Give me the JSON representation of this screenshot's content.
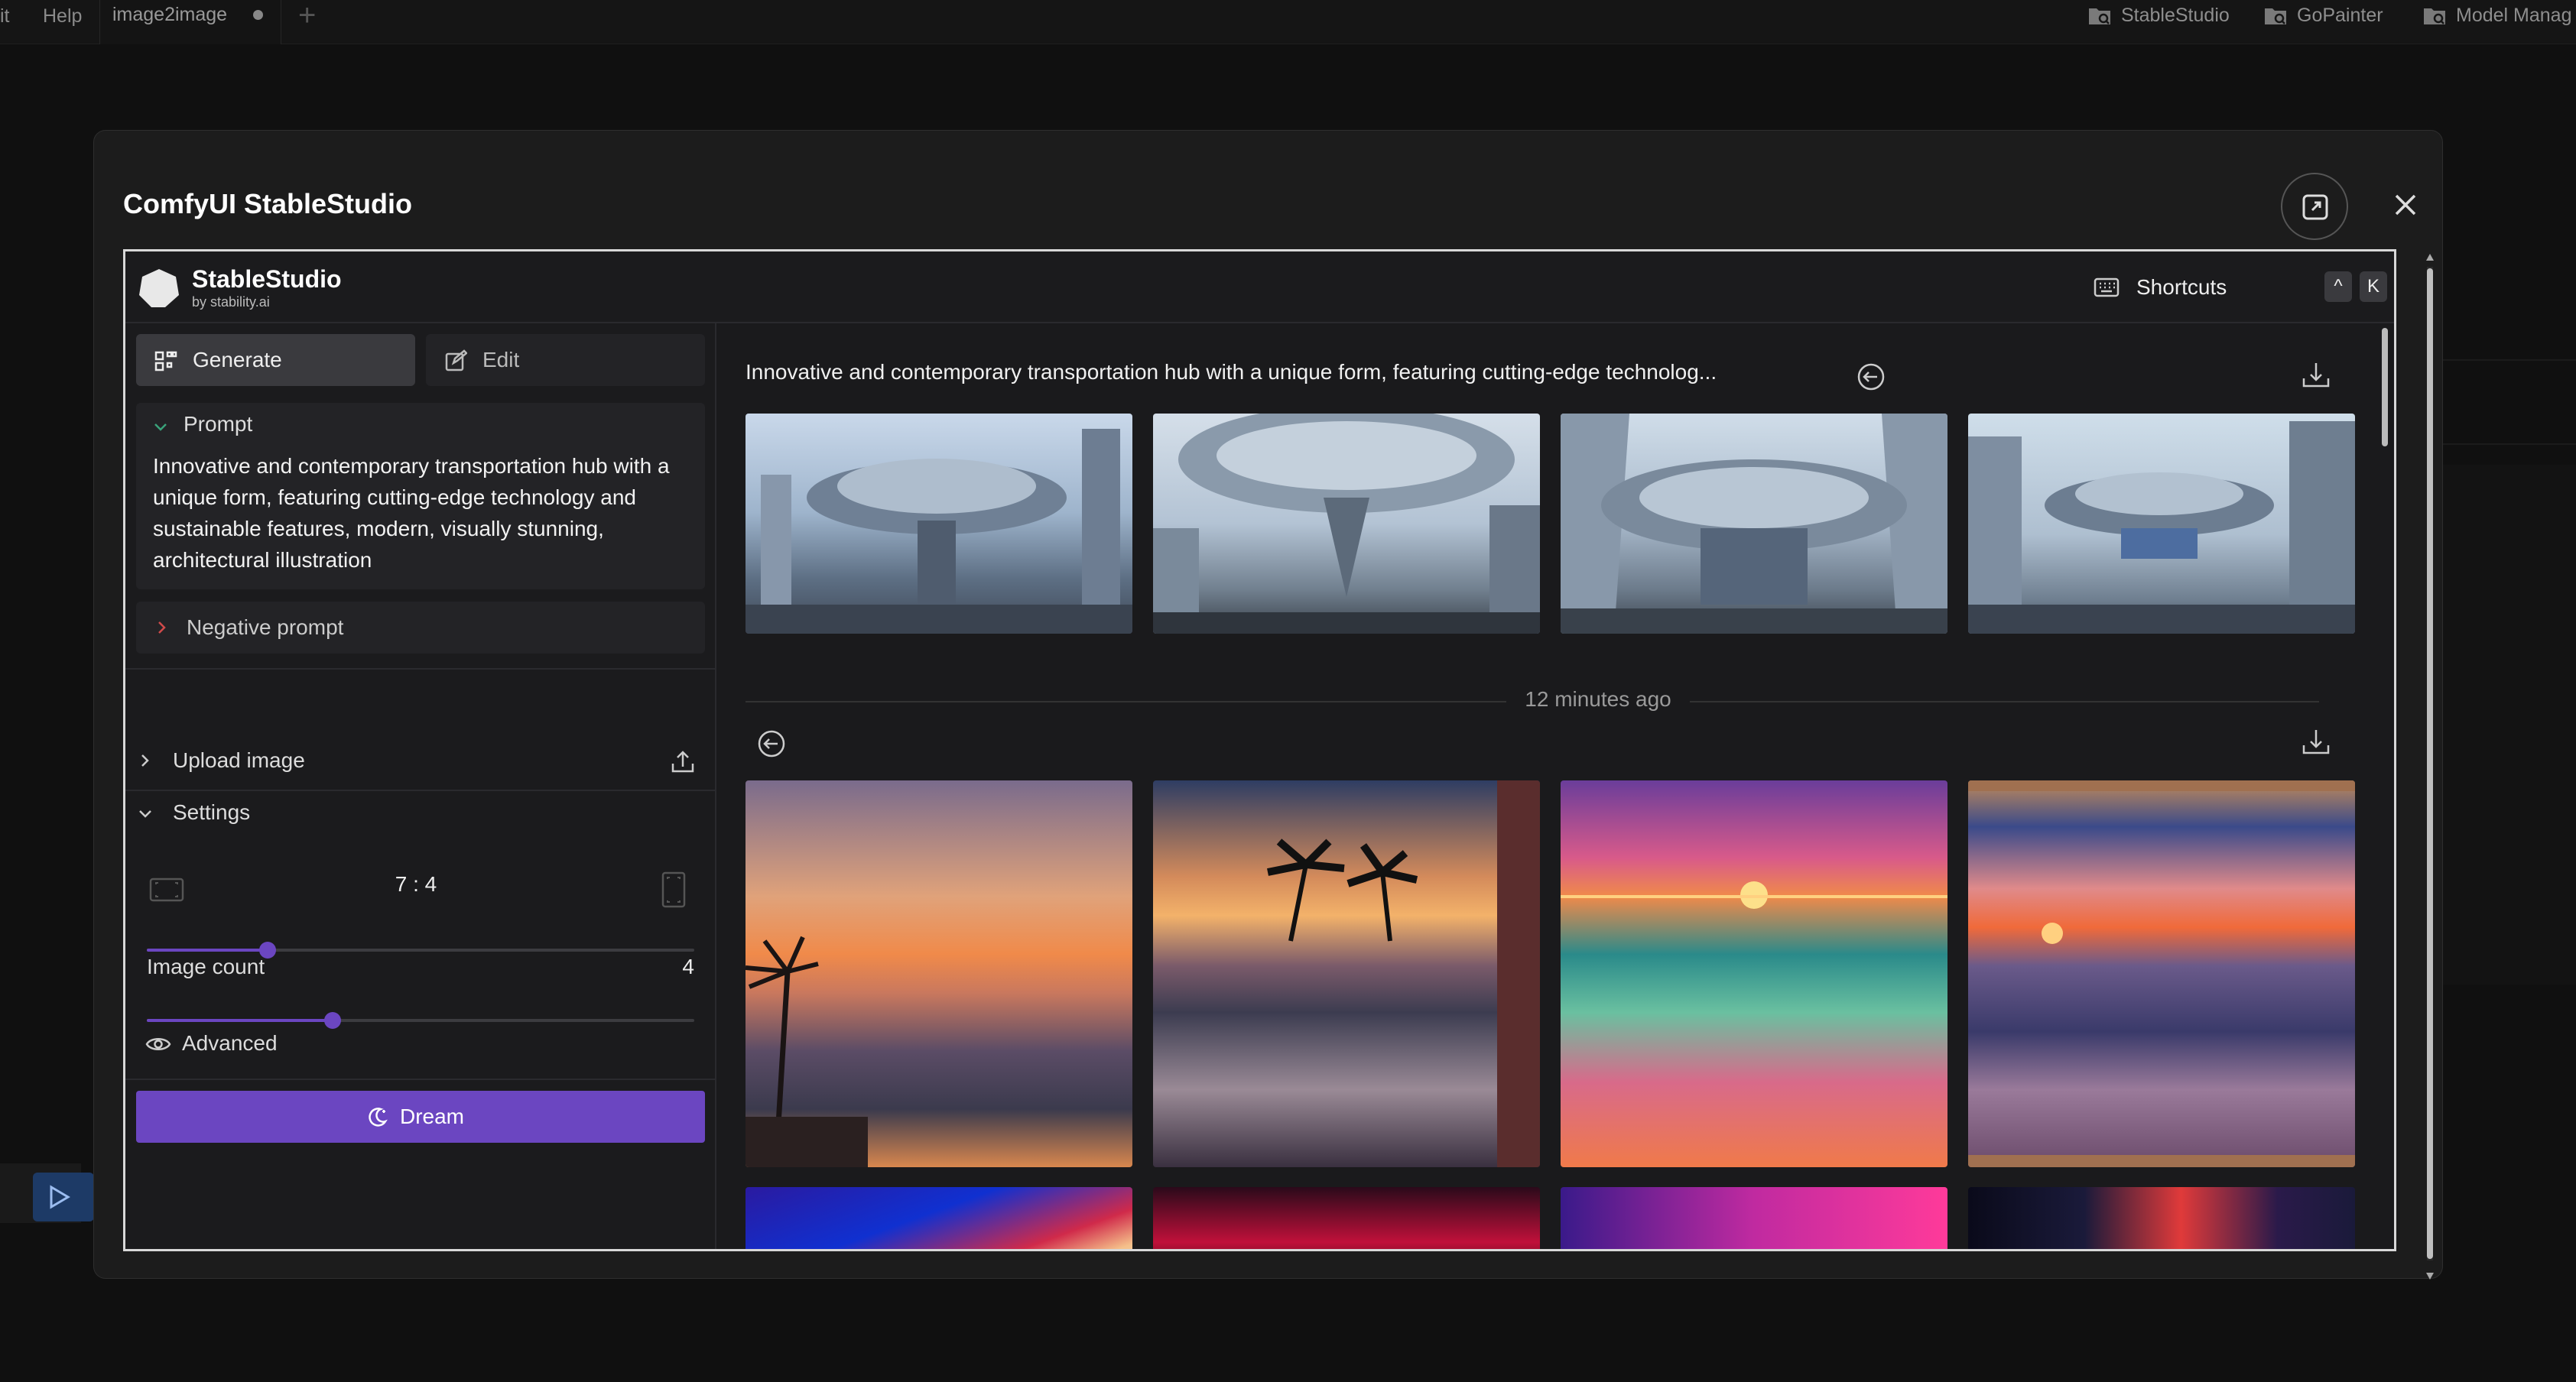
{
  "topbar": {
    "menu_partial": "it",
    "help": "Help",
    "tab_title": "image2image",
    "buttons": [
      "StableStudio",
      "GoPainter",
      "Model Manag"
    ]
  },
  "dialog": {
    "title": "ComfyUI StableStudio"
  },
  "app": {
    "brand": "StableStudio",
    "brand_sub": "by stability.ai",
    "shortcuts_label": "Shortcuts",
    "shortcut_keys": [
      "^",
      "K"
    ]
  },
  "sidebar": {
    "tab_generate": "Generate",
    "tab_edit": "Edit",
    "prompt_header": "Prompt",
    "prompt_text": "Innovative and contemporary transportation hub with a unique form, featuring cutting-edge technology and sustainable features, modern, visually stunning, architectural illustration",
    "negative_prompt": "Negative prompt",
    "upload_image": "Upload image",
    "settings": "Settings",
    "aspect_ratio": "7 : 4",
    "aspect_ratio_level": 0.22,
    "image_count_label": "Image count",
    "image_count": "4",
    "image_count_level": 0.34,
    "advanced": "Advanced",
    "dream": "Dream"
  },
  "gallery": {
    "prompt_1": "Innovative and contemporary transportation hub with a unique form, featuring cutting-edge technolog...",
    "timestamp": "12 minutes ago"
  },
  "colors": {
    "accent": "#6b46c1",
    "background": "#1a1a1c"
  }
}
